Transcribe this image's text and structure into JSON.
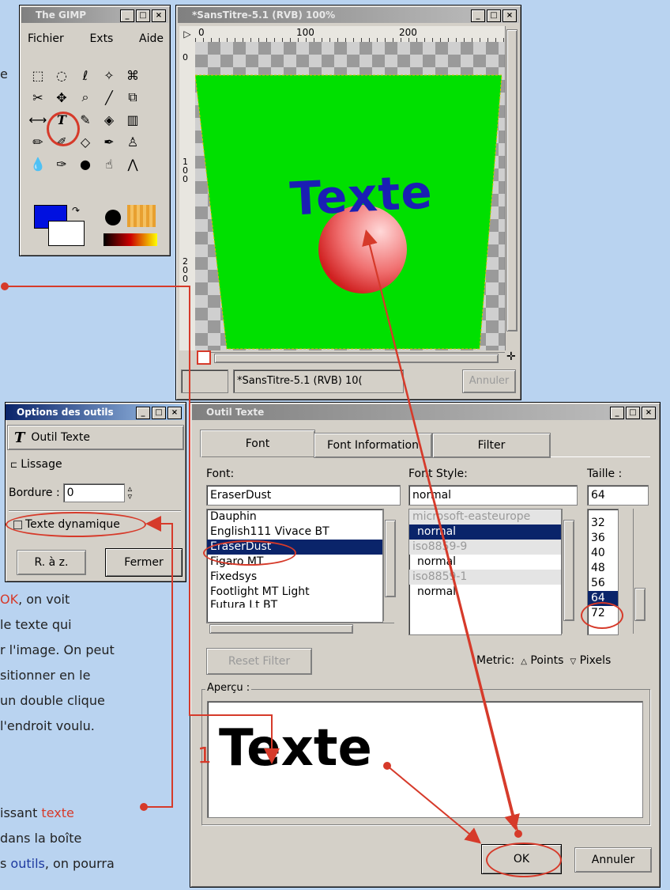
{
  "toolbox": {
    "title": "The GIMP",
    "menu": [
      "Fichier",
      "Exts",
      "Aide"
    ]
  },
  "image_window": {
    "title": "*SansTitre-5.1 (RVB) 100%",
    "ruler_top": [
      "0",
      "100",
      "200"
    ],
    "ruler_left": [
      "0",
      "100",
      "200"
    ],
    "canvas_text": "Texte",
    "status_text": "*SansTitre-5.1 (RVB) 10(",
    "cancel_label": "Annuler"
  },
  "tool_options": {
    "title": "Options des outils",
    "tool_name": "Outil Texte",
    "smoothing_label": "Lissage",
    "border_label": "Bordure :",
    "border_value": "0",
    "dynamic_label": "Texte dynamique",
    "reset_label": "R. à z.",
    "close_label": "Fermer"
  },
  "text_tool": {
    "title": "Outil Texte",
    "tabs": [
      "Font",
      "Font Information",
      "Filter"
    ],
    "font_label": "Font:",
    "font_value": "EraserDust",
    "style_label": "Font Style:",
    "style_value": "normal",
    "size_label": "Taille :",
    "size_value": "64",
    "fonts": [
      "Dauphin",
      "English111 Vivace BT",
      "EraserDust",
      "Figaro MT",
      "Fixedsys",
      "Footlight MT Light",
      "Futura Lt BT"
    ],
    "styles": [
      "microsoft-easteurope",
      "normal",
      "iso8859-9",
      "normal",
      "iso8859-1",
      "normal"
    ],
    "sizes": [
      "32",
      "36",
      "40",
      "48",
      "56",
      "64",
      "72"
    ],
    "reset_filter": "Reset Filter",
    "metric_label": "Metric:",
    "metric_points": "Points",
    "metric_pixels": "Pixels",
    "preview_label": "Aperçu :",
    "preview_text": "Texte",
    "ok_label": "OK",
    "cancel_label": "Annuler"
  },
  "captions": {
    "top_e": "e",
    "marker_1": "1",
    "p1_l1a": "OK",
    "p1_l1b": ", on voit",
    "p1_l2": "le texte qui",
    "p1_l3": "r l'image. On peut",
    "p1_l4": "sitionner en le",
    "p1_l5": "un double clique",
    "p1_l6": "l'endroit voulu.",
    "p2_l1a": "issant ",
    "p2_l1b": "texte",
    "p2_l2": "dans la boîte",
    "p2_l3a": "s ",
    "p2_l3b": "outils",
    "p2_l3c": ", on pourra"
  },
  "colors": {
    "annotation_red": "#d63a2a",
    "canvas_green": "#00e000",
    "text_blue": "#1a1fb4",
    "selection": "#0a246a"
  }
}
